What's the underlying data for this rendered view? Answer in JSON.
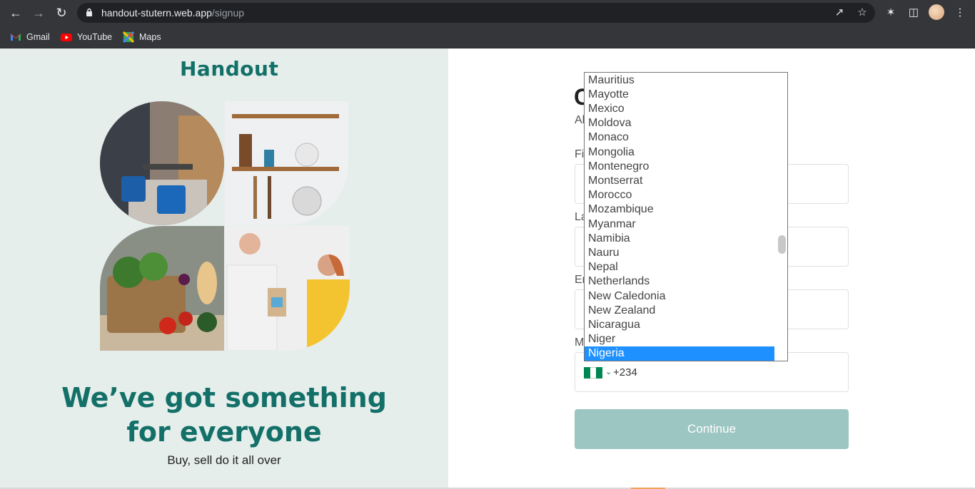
{
  "browser": {
    "url_host": "handout-stutern.web.app",
    "url_path": "/signup",
    "bookmarks": [
      {
        "label": "Gmail",
        "icon": "gmail-icon"
      },
      {
        "label": "YouTube",
        "icon": "youtube-icon"
      },
      {
        "label": "Maps",
        "icon": "maps-icon"
      }
    ]
  },
  "left_panel": {
    "logo": "Handout",
    "headline_line1": "We’ve got something",
    "headline_line2": "for everyone",
    "subline": "Buy, sell do it all over"
  },
  "form": {
    "title_partial": "C",
    "subtitle_partial": "Al",
    "first_name_label_partial": "Fi",
    "last_name_label_partial": "La",
    "email_label_partial": "Er",
    "mobile_label_partial": "M",
    "dial_code": "+234",
    "continue_label": "Continue"
  },
  "country_dropdown": {
    "options": [
      "Mauritius",
      "Mayotte",
      "Mexico",
      "Moldova",
      "Monaco",
      "Mongolia",
      "Montenegro",
      "Montserrat",
      "Morocco",
      "Mozambique",
      "Myanmar",
      "Namibia",
      "Nauru",
      "Nepal",
      "Netherlands",
      "New Caledonia",
      "New Zealand",
      "Nicaragua",
      "Niger",
      "Nigeria"
    ],
    "selected": "Nigeria"
  },
  "colors": {
    "brand": "#137068",
    "left_bg": "#e5eeeb",
    "button_disabled": "#9cc6c2",
    "selection": "#1e90ff"
  }
}
